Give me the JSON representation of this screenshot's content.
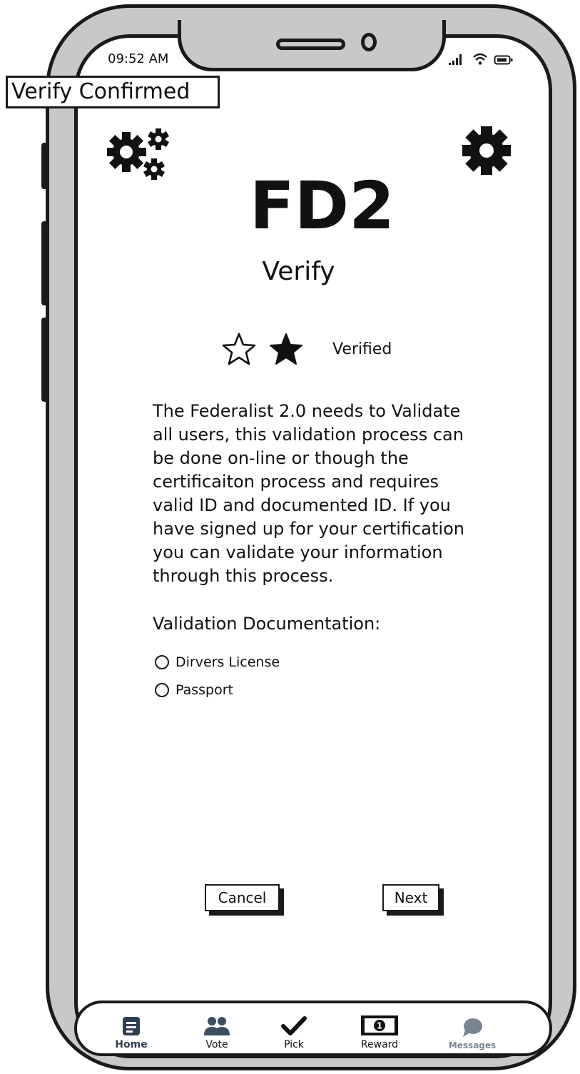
{
  "status_bar": {
    "time": "09:52 AM"
  },
  "screen_label": "Verify Confirmed",
  "app": {
    "brand": "FD2",
    "title": "Verify"
  },
  "rating": {
    "filled_stars": 1,
    "total_stars": 2,
    "label": "Verified"
  },
  "description": "The Federalist 2.0 needs to Validate\nall users, this validation process can\nbe done on-line or though the\ncertificaiton process and requires\nvalid ID and documented ID. If you\nhave signed up for your certification\nyou can validate your information\nthrough this process.",
  "documentation": {
    "heading": "Validation Documentation:",
    "options": [
      "Dirvers License",
      "Passport"
    ]
  },
  "buttons": {
    "cancel": "Cancel",
    "next": "Next"
  },
  "tabbar": {
    "items": [
      {
        "label": "Home",
        "icon": "home-icon",
        "color": "#2f3f52"
      },
      {
        "label": "Vote",
        "icon": "users-icon",
        "color": "#3e4f63"
      },
      {
        "label": "Pick",
        "icon": "checkmark-icon",
        "color": "#111111"
      },
      {
        "label": "Reward",
        "icon": "money-icon",
        "color": "#111111"
      },
      {
        "label": "Messages",
        "icon": "message-bubble-icon",
        "color": "#7a8594"
      }
    ]
  },
  "colors": {
    "outline": "#1a1a1a",
    "shell": "#c8c8c8",
    "screen": "#ffffff"
  }
}
